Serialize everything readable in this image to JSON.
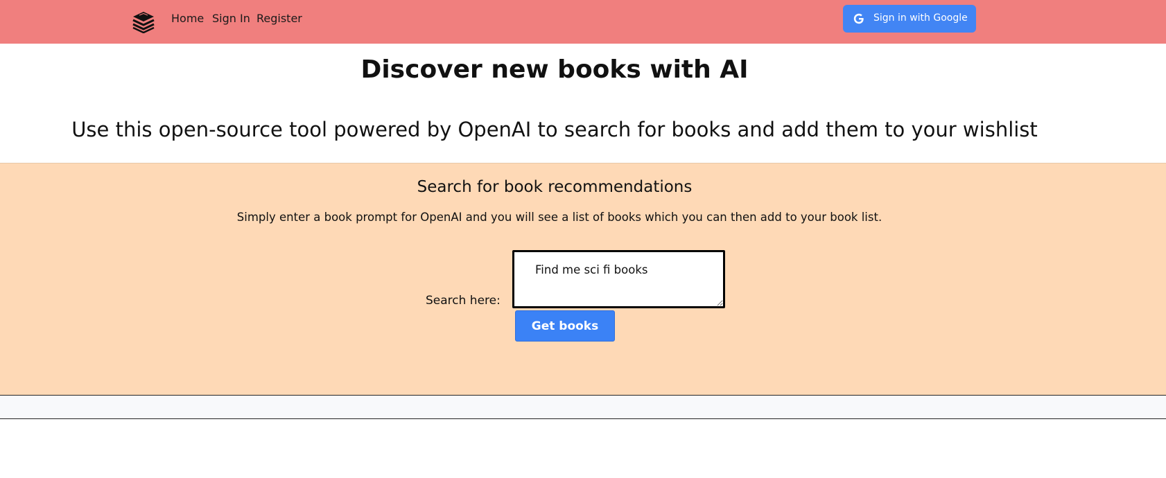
{
  "navbar": {
    "background": "#f07f7e",
    "logo_icon": "book-stack-icon",
    "links": {
      "home": "Home",
      "sign_in": "Sign In",
      "register": "Register"
    },
    "google_button": {
      "label": "Sign in with Google",
      "icon": "google-g-icon",
      "color": "#4285f4"
    }
  },
  "hero": {
    "title": "Discover new books with AI",
    "subtitle": "Use this open-source tool powered by OpenAI to search for books and add them to your wishlist"
  },
  "search": {
    "background": "#fed9b6",
    "heading": "Search for book recommendations",
    "description": "Simply enter a book prompt for OpenAI and you will see a list of books which you can then add to your book list.",
    "label": "Search here:",
    "input_value": "Find me sci fi books",
    "button_label": "Get books",
    "button_color": "#3b82f6"
  }
}
